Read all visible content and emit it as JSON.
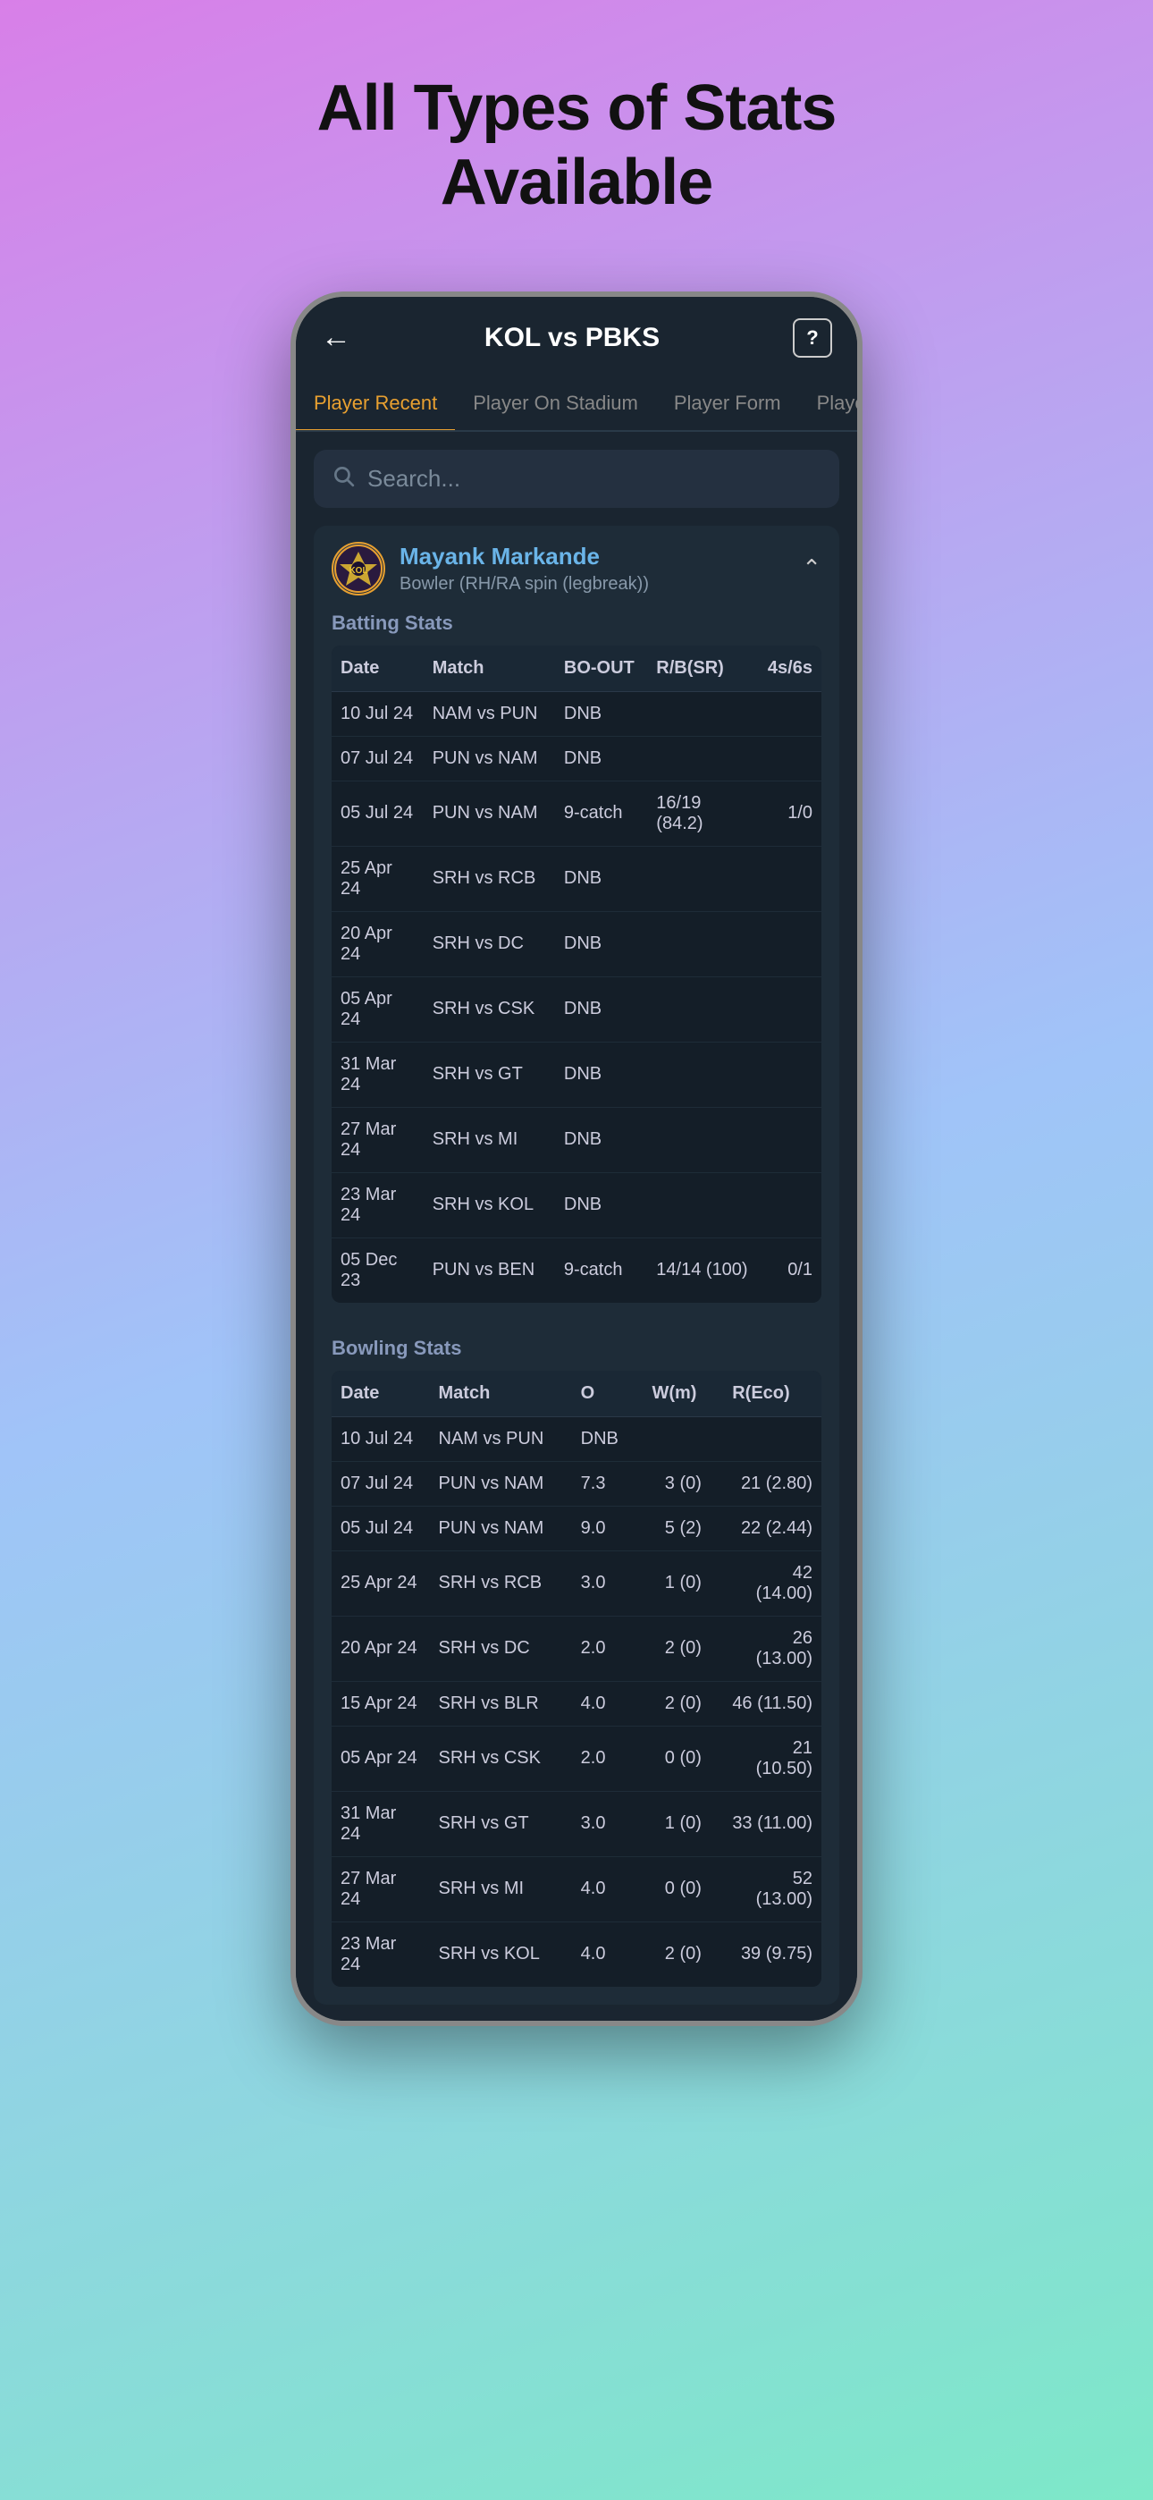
{
  "headline": "All Types of Stats\nAvailable",
  "topbar": {
    "title": "KOL vs PBKS",
    "help_label": "?"
  },
  "tabs": [
    {
      "label": "Player Recent",
      "active": true
    },
    {
      "label": "Player On Stadium",
      "active": false
    },
    {
      "label": "Player Form",
      "active": false
    },
    {
      "label": "Player",
      "active": false
    }
  ],
  "search": {
    "placeholder": "Search..."
  },
  "player": {
    "name": "Mayank Markande",
    "role": "Bowler (RH/RA spin (legbreak))",
    "batting_stats_title": "Batting Stats",
    "batting_headers": [
      "Date",
      "Match",
      "BO-OUT",
      "R/B(SR)",
      "4s/6s"
    ],
    "batting_rows": [
      {
        "date": "10 Jul 24",
        "match": "NAM vs PUN",
        "bo_out": "DNB",
        "rb": "",
        "s46": ""
      },
      {
        "date": "07 Jul 24",
        "match": "PUN vs NAM",
        "bo_out": "DNB",
        "rb": "",
        "s46": ""
      },
      {
        "date": "05 Jul 24",
        "match": "PUN vs NAM",
        "bo_out": "9-catch",
        "rb": "16/19 (84.2)",
        "s46": "1/0"
      },
      {
        "date": "25 Apr 24",
        "match": "SRH vs RCB",
        "bo_out": "DNB",
        "rb": "",
        "s46": ""
      },
      {
        "date": "20 Apr 24",
        "match": "SRH vs DC",
        "bo_out": "DNB",
        "rb": "",
        "s46": ""
      },
      {
        "date": "05 Apr 24",
        "match": "SRH vs CSK",
        "bo_out": "DNB",
        "rb": "",
        "s46": ""
      },
      {
        "date": "31 Mar 24",
        "match": "SRH vs GT",
        "bo_out": "DNB",
        "rb": "",
        "s46": ""
      },
      {
        "date": "27 Mar 24",
        "match": "SRH vs MI",
        "bo_out": "DNB",
        "rb": "",
        "s46": ""
      },
      {
        "date": "23 Mar 24",
        "match": "SRH vs KOL",
        "bo_out": "DNB",
        "rb": "",
        "s46": ""
      },
      {
        "date": "05 Dec 23",
        "match": "PUN vs BEN",
        "bo_out": "9-catch",
        "rb": "14/14 (100)",
        "s46": "0/1"
      }
    ],
    "bowling_stats_title": "Bowling Stats",
    "bowling_headers": [
      "Date",
      "Match",
      "O",
      "W(m)",
      "R(Eco)"
    ],
    "bowling_rows": [
      {
        "date": "10 Jul 24",
        "match": "NAM vs PUN",
        "o": "DNB",
        "w": "",
        "r": ""
      },
      {
        "date": "07 Jul 24",
        "match": "PUN vs NAM",
        "o": "7.3",
        "w": "3 (0)",
        "r": "21 (2.80)"
      },
      {
        "date": "05 Jul 24",
        "match": "PUN vs NAM",
        "o": "9.0",
        "w": "5 (2)",
        "r": "22 (2.44)"
      },
      {
        "date": "25 Apr 24",
        "match": "SRH vs RCB",
        "o": "3.0",
        "w": "1 (0)",
        "r": "42 (14.00)"
      },
      {
        "date": "20 Apr 24",
        "match": "SRH vs DC",
        "o": "2.0",
        "w": "2 (0)",
        "r": "26 (13.00)"
      },
      {
        "date": "15 Apr 24",
        "match": "SRH vs BLR",
        "o": "4.0",
        "w": "2 (0)",
        "r": "46 (11.50)"
      },
      {
        "date": "05 Apr 24",
        "match": "SRH vs CSK",
        "o": "2.0",
        "w": "0 (0)",
        "r": "21 (10.50)"
      },
      {
        "date": "31 Mar 24",
        "match": "SRH vs GT",
        "o": "3.0",
        "w": "1 (0)",
        "r": "33 (11.00)"
      },
      {
        "date": "27 Mar 24",
        "match": "SRH vs MI",
        "o": "4.0",
        "w": "0 (0)",
        "r": "52 (13.00)"
      },
      {
        "date": "23 Mar 24",
        "match": "SRH vs KOL",
        "o": "4.0",
        "w": "2 (0)",
        "r": "39 (9.75)"
      }
    ]
  }
}
